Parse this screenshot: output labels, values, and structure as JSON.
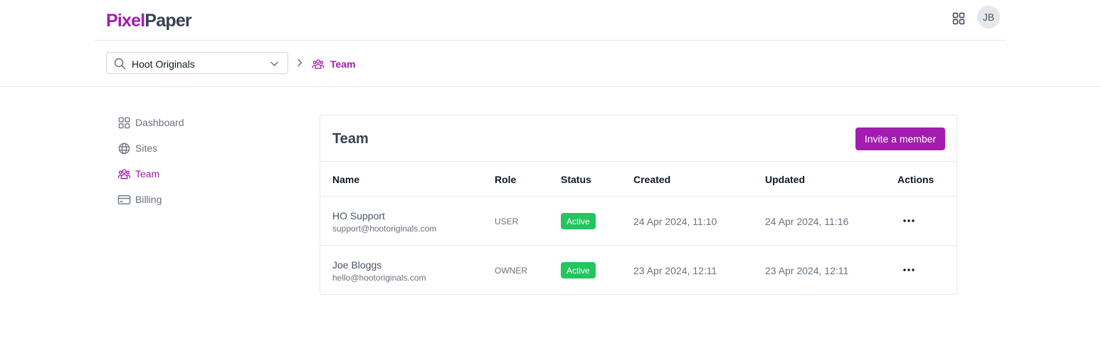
{
  "brand": {
    "part1": "Pixel",
    "part2": "Paper"
  },
  "user": {
    "initials": "JB"
  },
  "org_selector": {
    "value": "Hoot Originals"
  },
  "breadcrumb": {
    "current": "Team"
  },
  "sidebar": {
    "items": [
      {
        "label": "Dashboard",
        "icon": "dashboard-icon",
        "active": false
      },
      {
        "label": "Sites",
        "icon": "globe-icon",
        "active": false
      },
      {
        "label": "Team",
        "icon": "team-icon",
        "active": true
      },
      {
        "label": "Billing",
        "icon": "credit-card-icon",
        "active": false
      }
    ]
  },
  "team_card": {
    "title": "Team",
    "invite_label": "Invite a member",
    "columns": [
      "Name",
      "Role",
      "Status",
      "Created",
      "Updated",
      "Actions"
    ],
    "rows": [
      {
        "name": "HO Support",
        "email": "support@hootoriginals.com",
        "role": "USER",
        "status": "Active",
        "created": "24 Apr 2024, 11:10",
        "updated": "24 Apr 2024, 11:16"
      },
      {
        "name": "Joe Bloggs",
        "email": "hello@hootoriginals.com",
        "role": "OWNER",
        "status": "Active",
        "created": "23 Apr 2024, 12:11",
        "updated": "23 Apr 2024, 12:11"
      }
    ]
  },
  "colors": {
    "accent": "#a21caf",
    "status_active": "#22c55e",
    "border": "#e5e7eb"
  }
}
